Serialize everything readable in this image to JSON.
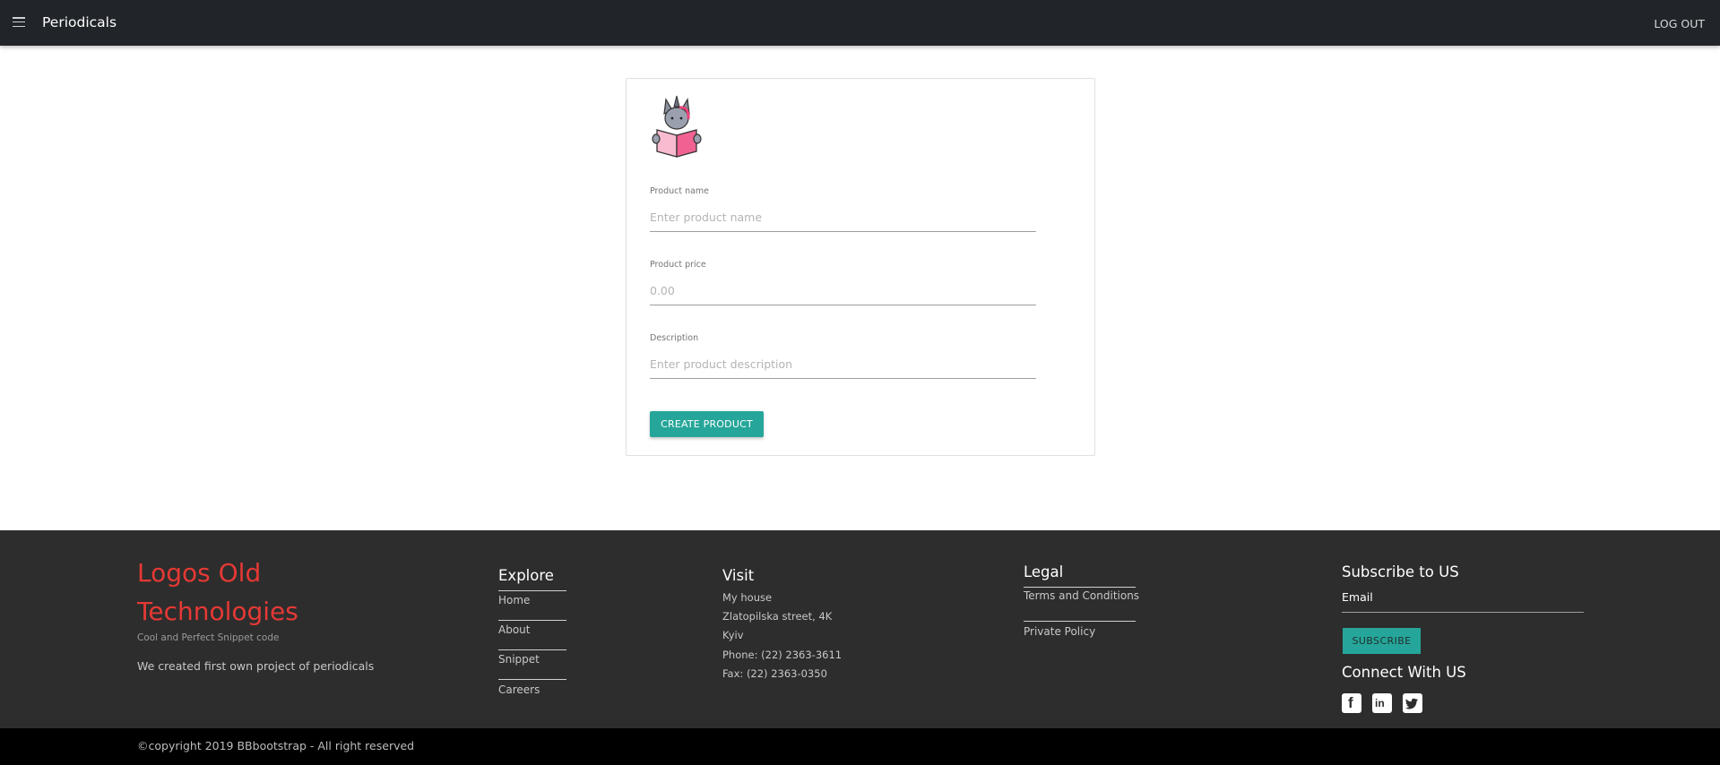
{
  "navbar": {
    "menu_icon": "hamburger-menu-icon",
    "brand": "Periodicals",
    "logout": "LOG OUT"
  },
  "form": {
    "avatar_icon": "unicorn-reading-book-icon",
    "name_label": "Product name",
    "name_placeholder": "Enter product name",
    "price_label": "Product price",
    "price_placeholder": "0.00",
    "description_label": "Description",
    "description_placeholder": "Enter product description",
    "submit_label": "CREATE PRODUCT"
  },
  "footer": {
    "logo_title_line1": "Logos Old",
    "logo_title_line2": "Technologies",
    "logo_subtitle": "Cool and Perfect Snippet code",
    "logo_description": "We created first own project of periodicals",
    "explore": {
      "heading": "Explore",
      "links": [
        "Home",
        "About",
        "Snippet",
        "Careers"
      ]
    },
    "visit": {
      "heading": "Visit",
      "lines": [
        "My house",
        "Zlatopilska street, 4K",
        "Kyiv",
        "Phone: (22) 2363-3611",
        "Fax: (22) 2363-0350"
      ]
    },
    "legal": {
      "heading": "Legal",
      "links": [
        "Terms and Conditions",
        "Private Policy"
      ]
    },
    "subscribe": {
      "heading": "Subscribe to US",
      "email_label": "Email",
      "button": "SUBSCRIBE"
    },
    "connect": {
      "heading": "Connect With US",
      "icons": [
        "facebook-icon",
        "linkedin-icon",
        "twitter-icon"
      ]
    },
    "copyright": "©copyright 2019 BBbootstrap - All right reserved"
  },
  "colors": {
    "navbar_bg": "#212529",
    "footer_bg": "#2d2d2d",
    "accent_teal": "#26a69a",
    "logo_red": "#e53935"
  }
}
